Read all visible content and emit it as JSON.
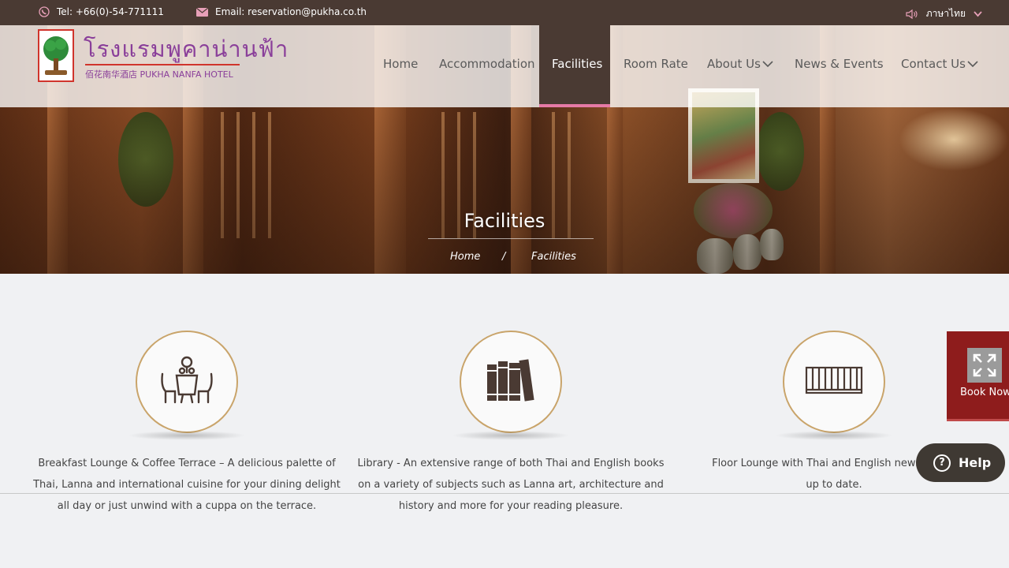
{
  "topbar": {
    "tel": "Tel: +66(0)-54-771111",
    "email": "Email: reservation@pukha.co.th",
    "language": "ภาษาไทย"
  },
  "logo": {
    "thai_name": "โรงแรมพูคาน่านฟ้า",
    "english_name": "佰花南华酒店 PUKHA NANFA HOTEL"
  },
  "nav": {
    "items": [
      {
        "label": "Home"
      },
      {
        "label": "Accommodation"
      },
      {
        "label": "Facilities"
      },
      {
        "label": "Room Rate"
      },
      {
        "label": "About Us"
      },
      {
        "label": "News & Events"
      },
      {
        "label": "Contact Us"
      }
    ],
    "active": "Facilities"
  },
  "hero": {
    "title": "Facilities",
    "breadcrumb": {
      "home": "Home",
      "separator": "/",
      "current": "Facilities"
    }
  },
  "facilities": [
    {
      "icon": "dining-table-icon",
      "lines": [
        "Breakfast Lounge & Coffee Terrace – A delicious palette of",
        "Thai, Lanna and international cuisine for your dining delight",
        "all day or just unwind with a cuppa on the terrace."
      ]
    },
    {
      "icon": "books-icon",
      "lines": [
        "Library - An extensive range of both Thai and English books",
        "on a variety of subjects such as Lanna art, architecture and",
        "history and more for your reading pleasure."
      ]
    },
    {
      "icon": "newspaper-rack-icon",
      "lines": [
        "Floor Lounge with Thai and English newspapers",
        "up to date."
      ]
    }
  ],
  "book_now": {
    "label": "Book Now"
  },
  "help": {
    "label": "Help"
  },
  "colors": {
    "brown": "#4a3a33",
    "accent_pink": "#e57aa6",
    "gold_ring": "#c9a46a",
    "book_red": "#8e1c1c",
    "logo_purple": "#8a3f9a"
  }
}
